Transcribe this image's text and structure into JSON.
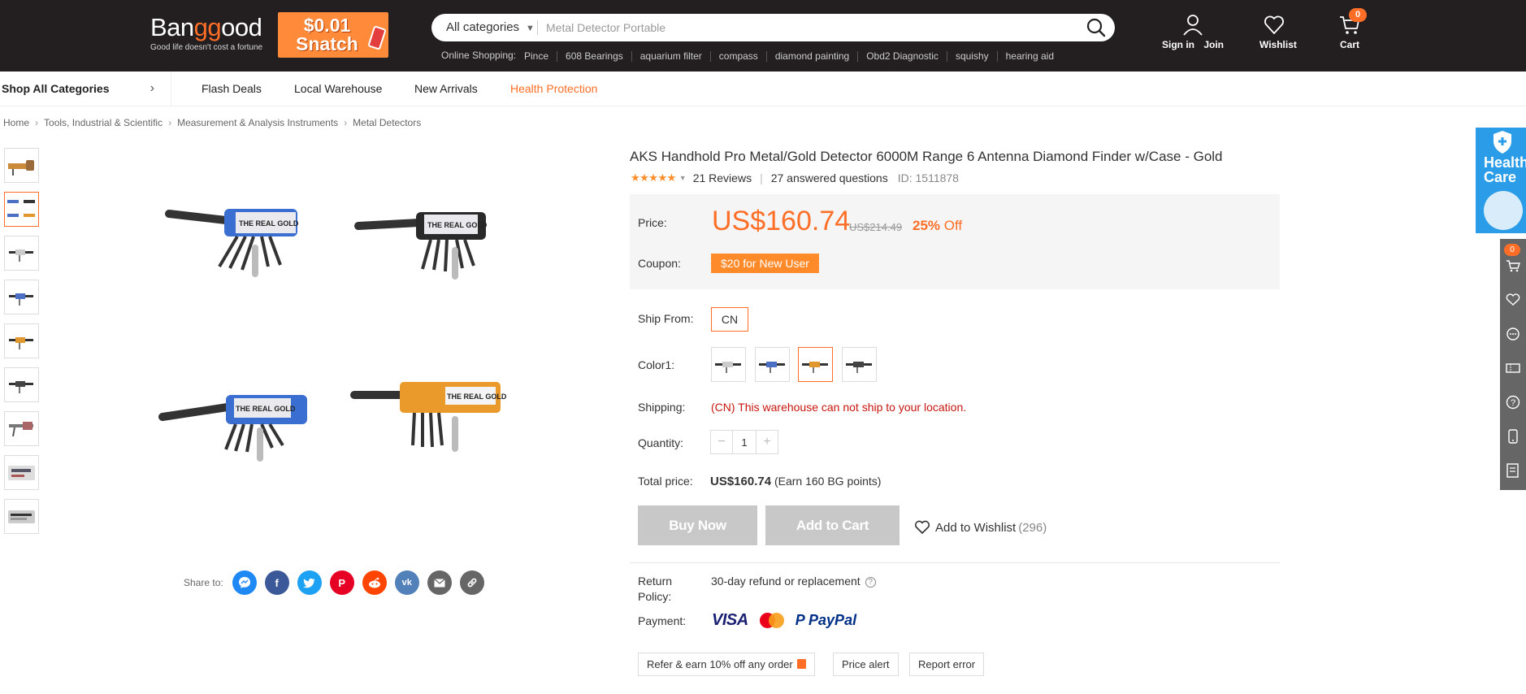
{
  "header": {
    "logo_text": "Banggood",
    "logo_tagline": "Good life doesn't cost a fortune",
    "promo": {
      "line1": "$0.01",
      "line2": "Snatch"
    },
    "search": {
      "category": "All categories",
      "placeholder": "Metal Detector Portable"
    },
    "hot_label": "Online Shopping:",
    "hot_searches": [
      "Pince",
      "608 Bearings",
      "aquarium filter",
      "compass",
      "diamond painting",
      "Obd2 Diagnostic",
      "squishy",
      "hearing aid"
    ],
    "sign_in": "Sign in",
    "join": "Join",
    "wishlist": "Wishlist",
    "cart": "Cart",
    "cart_count": "0"
  },
  "nav": {
    "shop_all": "Shop All Categories",
    "links": [
      "Flash Deals",
      "Local Warehouse",
      "New Arrivals",
      "Health Protection"
    ]
  },
  "breadcrumb": [
    "Home",
    "Tools, Industrial & Scientific",
    "Measurement & Analysis Instruments",
    "Metal Detectors"
  ],
  "product": {
    "title": "AKS Handhold Pro Metal/Gold Detector 6000M Range 6 Antenna Diamond Finder w/Case - Gold",
    "rating": 5,
    "reviews": "21 Reviews",
    "questions": "27 answered questions",
    "id": "ID: 1511878",
    "image_text": "THE REAL GOLD",
    "image_text_mirrored": "THE REAL GOLD"
  },
  "pricing": {
    "price_label": "Price:",
    "price": "US$160.74",
    "old_price": "US$214.49",
    "discount_pct": "25%",
    "discount_word": "Off",
    "coupon_label": "Coupon:",
    "coupon": "$20 for New User"
  },
  "options": {
    "ship_from_label": "Ship From:",
    "ship_from": "CN",
    "color_label": "Color1:",
    "colors": [
      "silver",
      "blue",
      "gold",
      "black"
    ],
    "selected_color": "gold",
    "shipping_label": "Shipping:",
    "shipping_msg": "(CN) This warehouse can not ship to your location.",
    "quantity_label": "Quantity:",
    "quantity": "1",
    "total_label": "Total price:",
    "total_price": "US$160.74",
    "points": "(Earn 160 BG points)"
  },
  "actions": {
    "buy_now": "Buy Now",
    "add_to_cart": "Add to Cart",
    "add_to_wishlist": "Add to Wishlist",
    "wishlist_count": "(296)"
  },
  "policies": {
    "return_label": "Return Policy:",
    "return_text": "30-day refund or replacement",
    "payment_label": "Payment:",
    "payment_methods": [
      "VISA",
      "MasterCard",
      "PayPal"
    ]
  },
  "extra_buttons": {
    "refer": "Refer & earn 10% off any order",
    "price_alert": "Price alert",
    "report_error": "Report error"
  },
  "share": {
    "label": "Share to:",
    "networks": [
      "messenger",
      "facebook",
      "twitter",
      "pinterest",
      "reddit",
      "vk",
      "email",
      "link"
    ]
  },
  "side": {
    "health_line1": "Health",
    "health_line2": "Care",
    "cart_badge": "0",
    "rail_icons": [
      "cart-icon",
      "heart-icon",
      "chat-icon",
      "coupon-icon",
      "help-icon",
      "mobile-icon",
      "feedback-icon"
    ]
  },
  "colors": {
    "brand_orange": "#ff6e26",
    "header_bg": "#231f20",
    "error_red": "#c7160f",
    "disabled_btn": "#c8c8c8"
  }
}
